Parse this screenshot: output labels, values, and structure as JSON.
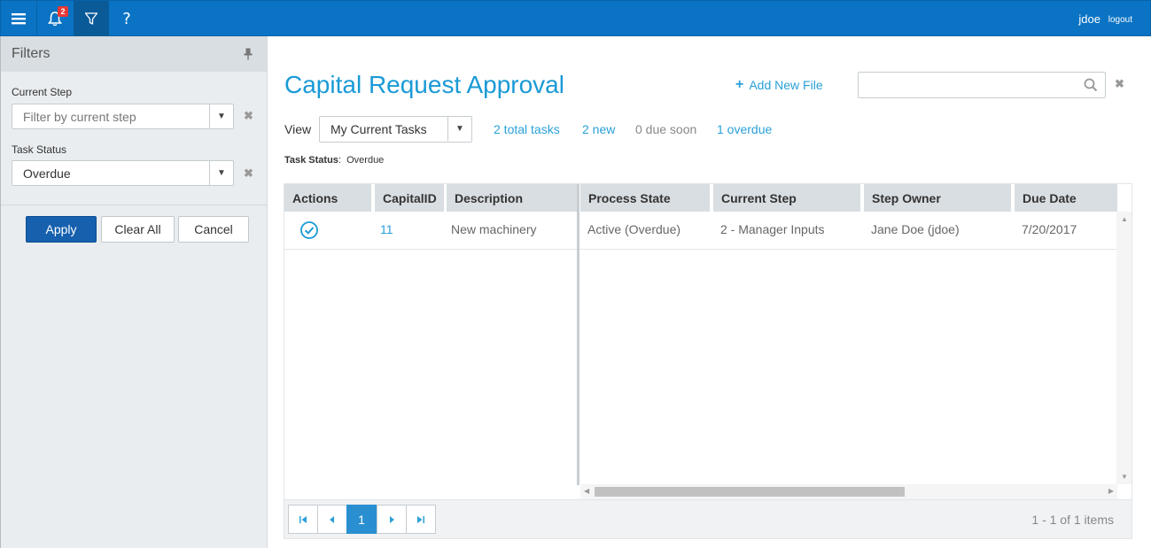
{
  "topbar": {
    "notification_count": "2",
    "help_label": "?",
    "username": "jdoe",
    "logout_label": "logout"
  },
  "sidebar": {
    "title": "Filters",
    "current_step_label": "Current Step",
    "current_step_placeholder": "Filter by current step",
    "task_status_label": "Task Status",
    "task_status_value": "Overdue",
    "apply_label": "Apply",
    "clear_all_label": "Clear All",
    "cancel_label": "Cancel"
  },
  "main": {
    "title": "Capital Request Approval",
    "add_new_file_label": "Add New File",
    "search_placeholder": "",
    "view_label": "View",
    "view_value": "My Current Tasks",
    "stats": {
      "total": "2 total tasks",
      "new": "2 new",
      "due_soon": "0 due soon",
      "overdue": "1 overdue"
    },
    "filter_summary": {
      "label": "Task Status",
      "value": "Overdue"
    }
  },
  "grid": {
    "columns": [
      "Actions",
      "CapitalID",
      "Description",
      "Process State",
      "Current Step",
      "Step Owner",
      "Due Date"
    ],
    "rows": [
      {
        "capital_id": "11",
        "description": "New machinery",
        "process_state": "Active (Overdue)",
        "current_step": "2 - Manager Inputs",
        "step_owner": "Jane Doe (jdoe)",
        "due_date": "7/20/2017"
      }
    ],
    "pager": {
      "current_page": "1",
      "info": "1 - 1 of 1 items"
    }
  },
  "colors": {
    "topbar": "#0a73c4",
    "accent": "#1a9ad6",
    "primary_button": "#1660ae"
  }
}
